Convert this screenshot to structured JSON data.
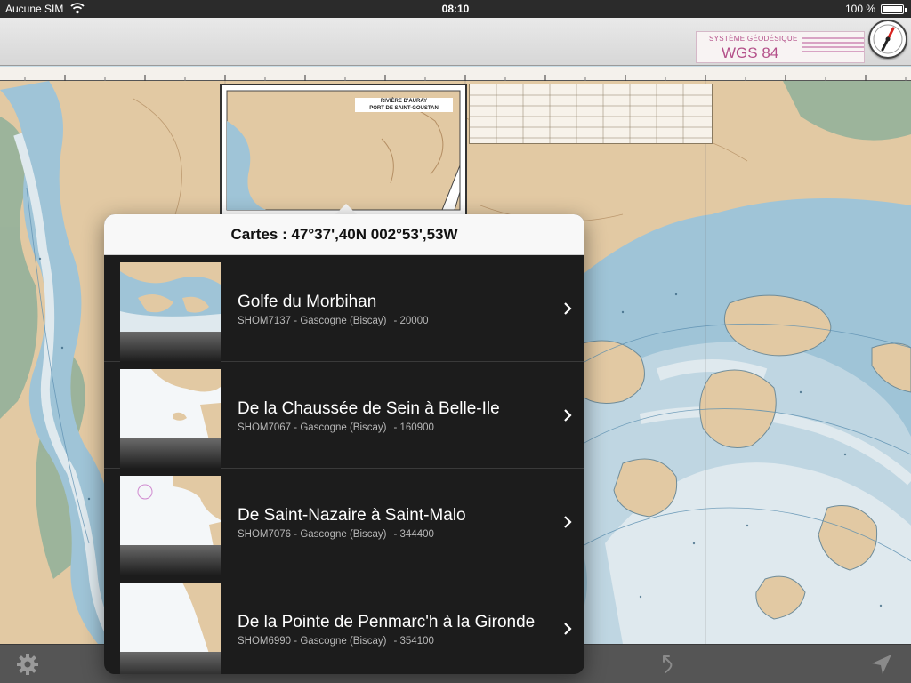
{
  "status_bar": {
    "carrier": "Aucune SIM",
    "time": "08:10",
    "battery": "100 %"
  },
  "datum_box": {
    "label": "SYSTÈME GÉODÉSIQUE",
    "value": "WGS 84"
  },
  "chart_inset": {
    "title_line1": "RIVIÈRE D'AURAY",
    "title_line2": "PORT DE SAINT-GOUSTAN"
  },
  "popover": {
    "title": "Cartes : 47°37',40N 002°53',53W",
    "items": [
      {
        "title": "Golfe du Morbihan",
        "code": "SHOM7137",
        "region": "Gascogne (Biscay)",
        "scale": "20000"
      },
      {
        "title": "De la Chaussée de Sein à Belle-Ile",
        "code": "SHOM7067",
        "region": "Gascogne (Biscay)",
        "scale": "160900"
      },
      {
        "title": "De Saint-Nazaire à Saint-Malo",
        "code": "SHOM7076",
        "region": "Gascogne (Biscay)",
        "scale": "344400"
      },
      {
        "title": "De la Pointe de Penmarc'h à la Gironde",
        "code": "SHOM6990",
        "region": "Gascogne (Biscay)",
        "scale": "354100"
      }
    ]
  },
  "icons": {
    "wifi": "wifi-icon",
    "battery": "battery-icon",
    "compass": "compass-icon",
    "settings": "gear-icon",
    "route": "route-icon",
    "locate": "location-arrow-icon",
    "disclosure": "chevron-right-icon"
  },
  "colors": {
    "land": "#e2c9a3",
    "shallow_water": "#9fc4d7",
    "deep_water": "#dfe9ee",
    "marsh": "#8fb09a",
    "popover_bg": "#1c1c1c",
    "datum_accent": "#b4508a"
  }
}
